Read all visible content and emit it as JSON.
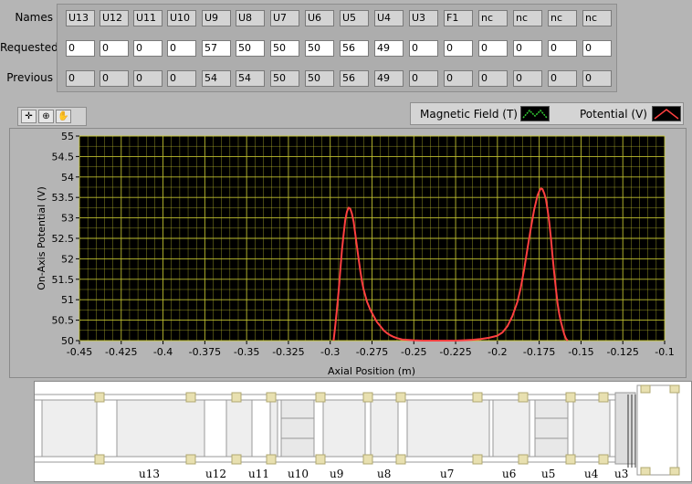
{
  "rows": {
    "names_label": "Names",
    "requested_label": "Requested",
    "previous_label": "Previous",
    "names": [
      "U13",
      "U12",
      "U11",
      "U10",
      "U9",
      "U8",
      "U7",
      "U6",
      "U5",
      "U4",
      "U3",
      "F1",
      "nc",
      "nc",
      "nc",
      "nc"
    ],
    "requested": [
      "0",
      "0",
      "0",
      "0",
      "57",
      "50",
      "50",
      "50",
      "56",
      "49",
      "0",
      "0",
      "0",
      "0",
      "0",
      "0"
    ],
    "previous": [
      "0",
      "0",
      "0",
      "0",
      "54",
      "54",
      "50",
      "50",
      "56",
      "49",
      "0",
      "0",
      "0",
      "0",
      "0",
      "0"
    ]
  },
  "legend": {
    "magnetic_label": "Magnetic Field (T)",
    "potential_label": "Potential (V)",
    "magnetic_color": "#33cc33",
    "potential_color": "#ff4040"
  },
  "toolbar": {
    "cursor_icon": "crosshair-icon",
    "zoom_icon": "zoom-icon",
    "pan_icon": "hand-pan-icon"
  },
  "chart_data": {
    "type": "line",
    "xlabel": "Axial Position (m)",
    "ylabel": "On-Axis Potential (V)",
    "xlim": [
      -0.45,
      -0.1
    ],
    "ylim": [
      50,
      55
    ],
    "x_ticks": [
      "-0.45",
      "-0.425",
      "-0.4",
      "-0.375",
      "-0.35",
      "-0.325",
      "-0.3",
      "-0.275",
      "-0.25",
      "-0.225",
      "-0.2",
      "-0.175",
      "-0.15",
      "-0.125",
      "-0.1"
    ],
    "y_ticks": [
      "50",
      "50.5",
      "51",
      "51.5",
      "52",
      "52.5",
      "53",
      "53.5",
      "54",
      "54.5",
      "55"
    ],
    "grid": true,
    "background": "#000000",
    "grid_color": "#c8c832",
    "series": [
      {
        "name": "Potential (V)",
        "color": "#ff4040",
        "x": [
          -0.298,
          -0.297,
          -0.296,
          -0.295,
          -0.294,
          -0.293,
          -0.292,
          -0.291,
          -0.29,
          -0.289,
          -0.288,
          -0.287,
          -0.286,
          -0.285,
          -0.284,
          -0.283,
          -0.282,
          -0.281,
          -0.28,
          -0.278,
          -0.276,
          -0.274,
          -0.272,
          -0.27,
          -0.268,
          -0.266,
          -0.264,
          -0.262,
          -0.26,
          -0.257,
          -0.254,
          -0.25,
          -0.245,
          -0.24,
          -0.235,
          -0.23,
          -0.225,
          -0.22,
          -0.215,
          -0.21,
          -0.205,
          -0.2,
          -0.197,
          -0.194,
          -0.191,
          -0.188,
          -0.186,
          -0.184,
          -0.182,
          -0.18,
          -0.178,
          -0.176,
          -0.175,
          -0.174,
          -0.173,
          -0.172,
          -0.171,
          -0.17,
          -0.169,
          -0.168,
          -0.167,
          -0.166,
          -0.165,
          -0.164,
          -0.163,
          -0.162,
          -0.161,
          -0.16,
          -0.159,
          -0.158
        ],
        "y": [
          50.0,
          50.35,
          50.75,
          51.2,
          51.7,
          52.2,
          52.6,
          52.95,
          53.15,
          53.25,
          53.22,
          53.1,
          52.9,
          52.6,
          52.3,
          52.0,
          51.7,
          51.45,
          51.25,
          50.95,
          50.75,
          50.6,
          50.45,
          50.35,
          50.25,
          50.18,
          50.13,
          50.09,
          50.06,
          50.03,
          50.02,
          50.01,
          50.0,
          50.0,
          50.0,
          50.0,
          50.0,
          50.01,
          50.02,
          50.04,
          50.07,
          50.12,
          50.2,
          50.35,
          50.6,
          50.95,
          51.3,
          51.75,
          52.25,
          52.75,
          53.2,
          53.55,
          53.65,
          53.72,
          53.7,
          53.6,
          53.45,
          53.2,
          52.9,
          52.5,
          52.05,
          51.65,
          51.25,
          50.9,
          50.65,
          50.45,
          50.3,
          50.15,
          50.05,
          50.0
        ]
      }
    ]
  },
  "schematic": {
    "labels": [
      "u13",
      "u12",
      "u11",
      "u10",
      "u9",
      "u8",
      "u7",
      "u6",
      "u5",
      "u4",
      "u3"
    ]
  }
}
